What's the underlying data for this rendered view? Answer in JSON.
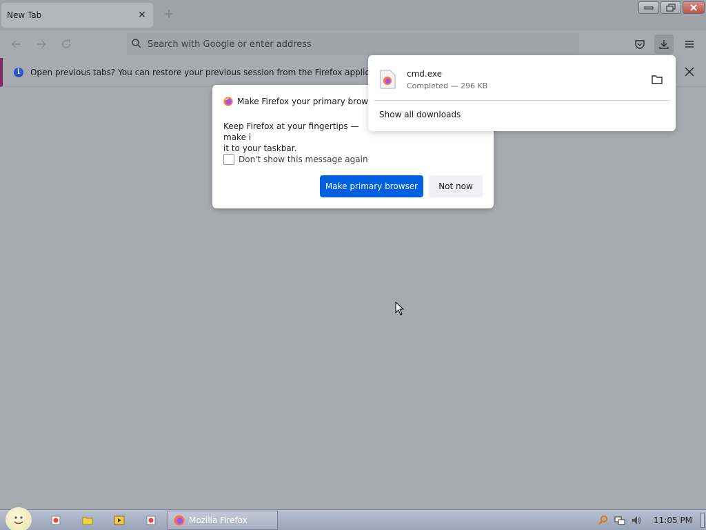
{
  "browser": {
    "tab": {
      "title": "New Tab"
    },
    "urlbar": {
      "placeholder": "Search with Google or enter address"
    }
  },
  "notification": {
    "text": "Open previous tabs? You can restore your previous session from the Firefox application menu"
  },
  "dialog": {
    "title": "Make Firefox your primary browser?",
    "body_line1": "Keep Firefox at your fingertips — make i",
    "body_line2": "it to your taskbar.",
    "checkbox_label": "Don't show this message again",
    "primary_label": "Make primary browser",
    "secondary_label": "Not now"
  },
  "downloads": {
    "item_name": "cmd.exe",
    "item_status": "Completed — 296 KB",
    "show_all": "Show all downloads"
  },
  "taskbar": {
    "active_task": "Mozilla Firefox",
    "clock": "11:05 PM"
  },
  "colors": {
    "accent": "#0060df",
    "notification_border": "#7e2d64"
  }
}
